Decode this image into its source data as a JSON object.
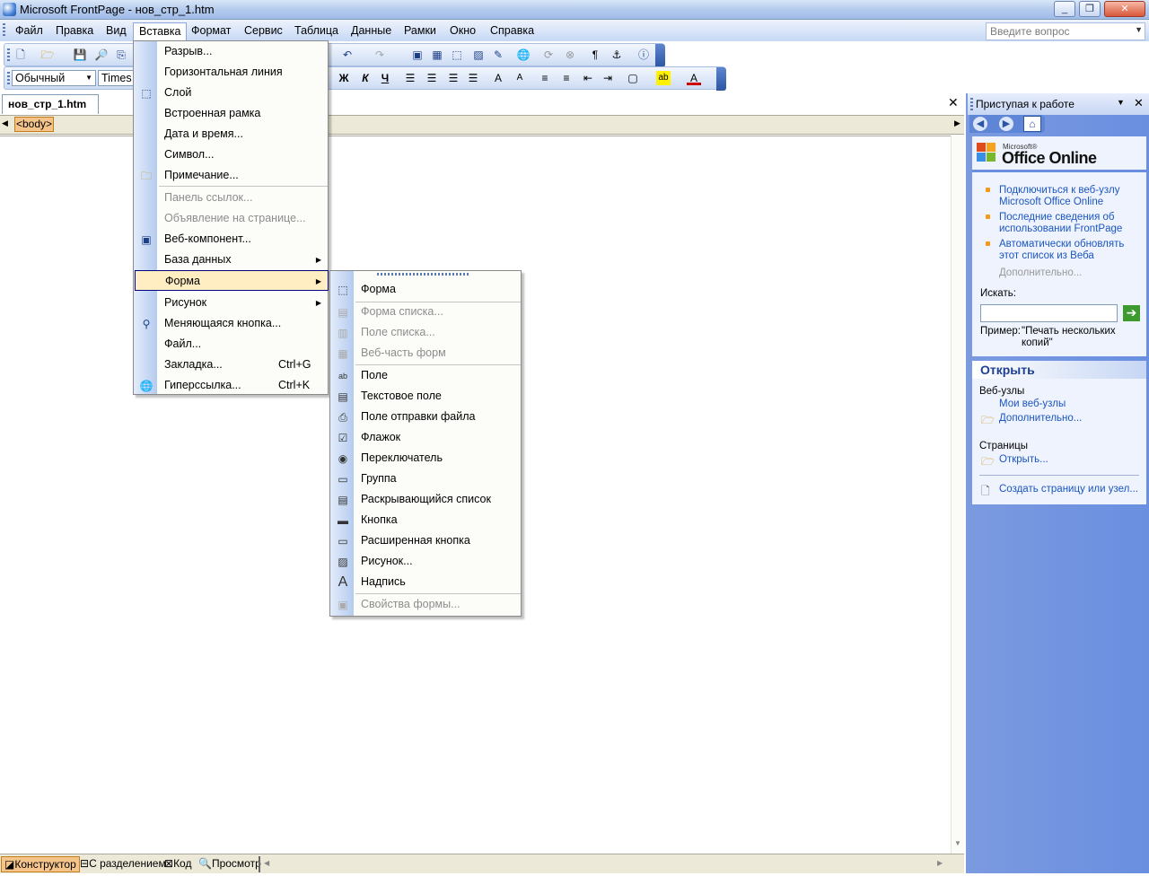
{
  "window": {
    "title": "Microsoft FrontPage - нов_стр_1.htm",
    "min_btn": "_",
    "max_btn": "❐",
    "close_btn": "✕"
  },
  "menubar": {
    "items": [
      "Файл",
      "Правка",
      "Вид",
      "Вставка",
      "Формат",
      "Сервис",
      "Таблица",
      "Данные",
      "Рамки",
      "Окно",
      "Справка"
    ],
    "help_placeholder": "Введите вопрос"
  },
  "formatting": {
    "style": "Обычный",
    "font": "Times New Roman"
  },
  "document": {
    "tab": "нов_стр_1.htm",
    "tag": "<body>",
    "close_btn": "✕"
  },
  "insert_menu": {
    "items": [
      {
        "label": "Разрыв...",
        "icon": "none",
        "disabled": false
      },
      {
        "label": "Горизонтальная линия",
        "icon": "none",
        "disabled": false
      },
      {
        "label": "Слой",
        "icon": "layer-icon",
        "disabled": false
      },
      {
        "label": "Встроенная рамка",
        "icon": "none",
        "disabled": false
      },
      {
        "label": "Дата и время...",
        "icon": "none",
        "disabled": false
      },
      {
        "label": "Символ...",
        "icon": "none",
        "disabled": false
      },
      {
        "label": "Примечание...",
        "icon": "comment-icon",
        "disabled": false
      },
      {
        "label": "Панель ссылок...",
        "icon": "none",
        "disabled": true
      },
      {
        "label": "Объявление на странице...",
        "icon": "none",
        "disabled": true
      },
      {
        "label": "Веб-компонент...",
        "icon": "web-component-icon",
        "disabled": false
      },
      {
        "label": "База данных",
        "icon": "none",
        "disabled": false,
        "submenu": true
      },
      {
        "label": "Форма",
        "icon": "none",
        "disabled": false,
        "submenu": true,
        "highlighted": true
      },
      {
        "label": "Рисунок",
        "icon": "none",
        "disabled": false,
        "submenu": true
      },
      {
        "label": "Меняющаяся кнопка...",
        "icon": "interactive-button-icon",
        "disabled": false
      },
      {
        "label": "Файл...",
        "icon": "none",
        "disabled": false
      },
      {
        "label": "Закладка...",
        "icon": "none",
        "disabled": false,
        "shortcut": "Ctrl+G"
      },
      {
        "label": "Гиперссылка...",
        "icon": "hyperlink-icon",
        "disabled": false,
        "shortcut": "Ctrl+K"
      }
    ]
  },
  "form_submenu": {
    "items": [
      {
        "label": "Форма",
        "icon": "form-icon",
        "disabled": false
      },
      {
        "label": "Форма списка...",
        "icon": "list-form-icon",
        "disabled": true
      },
      {
        "label": "Поле списка...",
        "icon": "list-field-icon",
        "disabled": true
      },
      {
        "label": "Веб-часть форм",
        "icon": "web-part-icon",
        "disabled": true
      },
      {
        "label": "Поле",
        "icon": "textbox-icon",
        "disabled": false
      },
      {
        "label": "Текстовое поле",
        "icon": "textarea-icon",
        "disabled": false
      },
      {
        "label": "Поле отправки файла",
        "icon": "file-upload-icon",
        "disabled": false
      },
      {
        "label": "Флажок",
        "icon": "checkbox-icon",
        "disabled": false
      },
      {
        "label": "Переключатель",
        "icon": "radio-icon",
        "disabled": false
      },
      {
        "label": "Группа",
        "icon": "group-box-icon",
        "disabled": false
      },
      {
        "label": "Раскрывающийся список",
        "icon": "dropdown-icon",
        "disabled": false
      },
      {
        "label": "Кнопка",
        "icon": "button-icon",
        "disabled": false
      },
      {
        "label": "Расширенная кнопка",
        "icon": "advanced-button-icon",
        "disabled": false
      },
      {
        "label": "Рисунок...",
        "icon": "picture-icon",
        "disabled": false
      },
      {
        "label": "Надпись",
        "icon": "label-icon",
        "disabled": false
      },
      {
        "label": "Свойства формы...",
        "icon": "form-properties-icon",
        "disabled": true
      }
    ]
  },
  "task_pane": {
    "title": "Приступая к работе",
    "office_online_small": "Microsoft®",
    "office_online": "Office Online",
    "links": [
      "Подключиться к веб-узлу Microsoft Office Online",
      "Последние сведения об использовании FrontPage",
      "Автоматически обновлять этот список из Веба"
    ],
    "more": "Дополнительно...",
    "search_label": "Искать:",
    "example_label": "Пример:",
    "example_text": "\"Печать нескольких копий\"",
    "open_header": "Открыть",
    "websites_label": "Веб-узлы",
    "my_websites": "Мои веб-узлы",
    "websites_more": "Дополнительно...",
    "pages_label": "Страницы",
    "open_link": "Открыть...",
    "create_link": "Создать страницу или узел..."
  },
  "view_buttons": [
    "Конструктор",
    "С разделением",
    "Код",
    "Просмотр"
  ],
  "colors": {
    "accent": "#6a8fe0",
    "highlight": "#ffeec2",
    "tag_orange": "#f4c48a"
  }
}
